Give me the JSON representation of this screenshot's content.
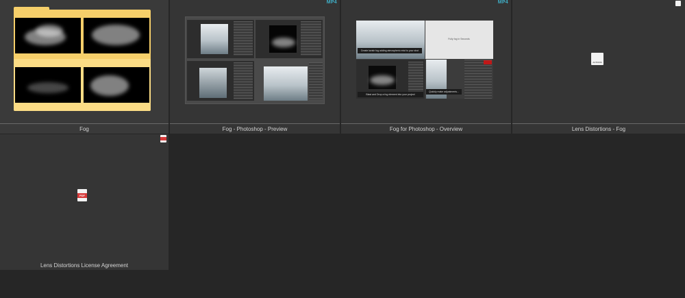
{
  "items": [
    {
      "name": "Fog",
      "type": "folder"
    },
    {
      "name": "Fog - Photoshop - Preview",
      "type": "video",
      "badge": "MP4"
    },
    {
      "name": "Fog for Photoshop - Overview",
      "type": "video",
      "badge": "MP4"
    },
    {
      "name": "Lens Distortions - Fog",
      "type": "action",
      "icon_text": "ACTIONS"
    },
    {
      "name": "Lens Distortions License Agreement",
      "type": "pdf",
      "icon_text": "PDF"
    }
  ],
  "overview_captions": [
    "Create lavish fog adding atmospheric mist to your shot",
    "Fully fog in Seconds",
    "Blast and Drop a fog element into your project",
    "Quickly make adjustments..."
  ],
  "colors": {
    "background": "#262626",
    "tile": "#353535",
    "folder": "#f6cf6a",
    "mp4_badge": "#3fb0c8",
    "pdf_red": "#d63a3a"
  }
}
